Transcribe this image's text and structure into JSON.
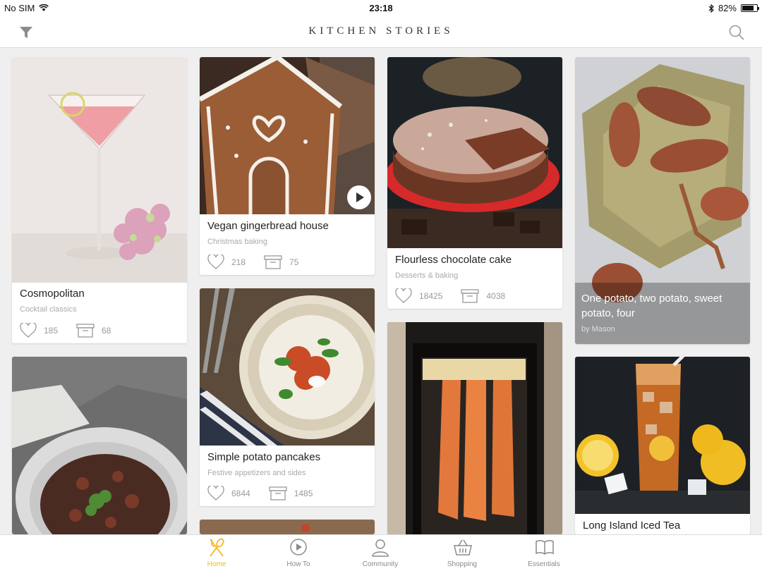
{
  "status_bar": {
    "carrier": "No SIM",
    "time": "23:18",
    "battery_pct": "82%",
    "battery_level": 0.82
  },
  "header": {
    "title": "KITCHEN STORIES"
  },
  "colors": {
    "accent": "#f5b81e",
    "background": "#efefef"
  },
  "cards": [
    {
      "title": "Cosmopolitan",
      "category": "Cocktail classics",
      "likes": "185",
      "saves": "68"
    },
    {
      "title": "Vegan gingerbread house",
      "category": "Christmas baking",
      "likes": "218",
      "saves": "75"
    },
    {
      "title": "Flourless chocolate cake",
      "category": "Desserts & baking",
      "likes": "18425",
      "saves": "4038"
    },
    {
      "title": "One potato, two potato, sweet potato, four",
      "byline": "by Mason"
    },
    {
      "title": "Simple potato pancakes",
      "category": "Festive appetizers and sides",
      "likes": "6844",
      "saves": "1485"
    },
    {
      "title": "Long Island Iced Tea"
    }
  ],
  "tabs": [
    {
      "label": "Home",
      "icon": "fork-spoon-icon",
      "active": true
    },
    {
      "label": "How To",
      "icon": "play-circle-icon"
    },
    {
      "label": "Community",
      "icon": "person-icon"
    },
    {
      "label": "Shopping",
      "icon": "basket-icon"
    },
    {
      "label": "Essentials",
      "icon": "book-icon"
    }
  ]
}
